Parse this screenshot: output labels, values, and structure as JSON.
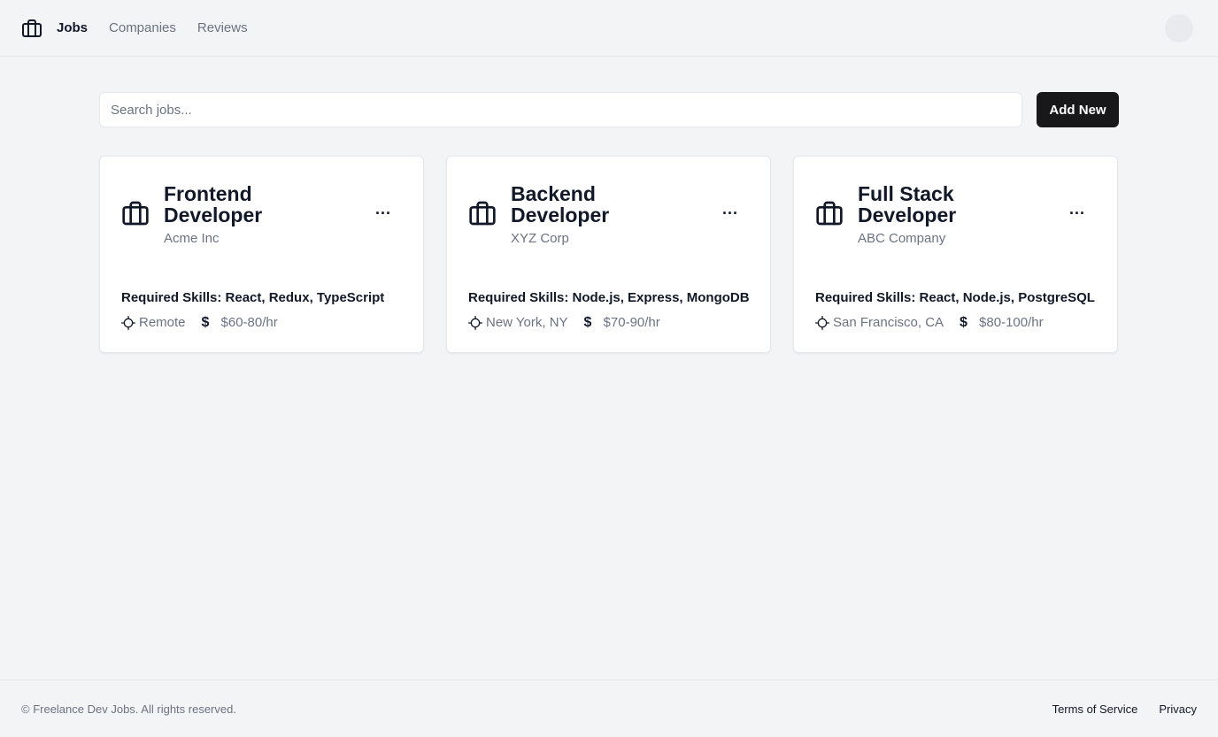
{
  "header": {
    "brand_icon": "briefcase-icon",
    "nav": [
      {
        "label": "Jobs",
        "active": true
      },
      {
        "label": "Companies",
        "active": false
      },
      {
        "label": "Reviews",
        "active": false
      }
    ]
  },
  "search": {
    "placeholder": "Search jobs...",
    "value": ""
  },
  "toolbar": {
    "add_label": "Add New"
  },
  "jobs": [
    {
      "title": "Frontend Developer",
      "company": "Acme Inc",
      "skills": "Required Skills: React, Redux, TypeScript",
      "location": "Remote",
      "rate": "$60-80/hr",
      "menu": "..."
    },
    {
      "title": "Backend Developer",
      "company": "XYZ Corp",
      "skills": "Required Skills: Node.js, Express, MongoDB",
      "location": "New York, NY",
      "rate": "$70-90/hr",
      "menu": "..."
    },
    {
      "title": "Full Stack Developer",
      "company": "ABC Company",
      "skills": "Required Skills: React, Node.js, PostgreSQL",
      "location": "San Francisco, CA",
      "rate": "$80-100/hr",
      "menu": "..."
    }
  ],
  "footer": {
    "copyright": "© Freelance Dev Jobs. All rights reserved.",
    "links": [
      "Terms of Service",
      "Privacy"
    ]
  },
  "colors": {
    "background": "#f3f4f6",
    "primary_button": "#18181b",
    "muted_text": "#6b7280"
  }
}
